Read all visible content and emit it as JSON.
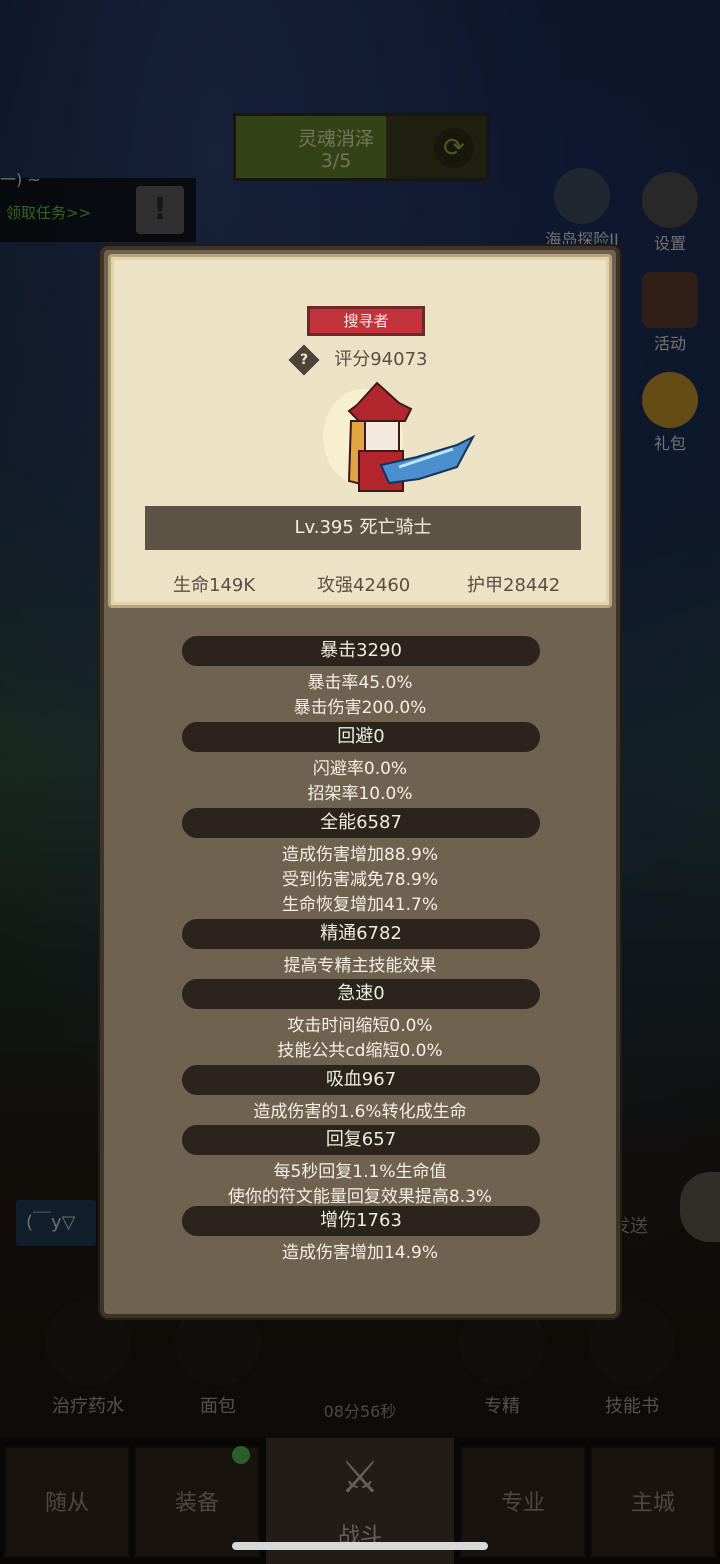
{
  "quest": {
    "title": "灵魂消泽",
    "progress": "3/5",
    "fill_fraction": 0.6
  },
  "task": {
    "top_text": "一) ~",
    "link": "领取任务>>"
  },
  "side_buttons": [
    {
      "label": "海岛探险II",
      "icon": "island-icon"
    },
    {
      "label": "设置",
      "icon": "gear-icon"
    },
    {
      "label": "活动",
      "icon": "calendar-icon"
    },
    {
      "label": "礼包",
      "icon": "gift-icon"
    }
  ],
  "character": {
    "rank": "搜寻者",
    "score": "评分94073",
    "name": "Lv.395 死亡骑士",
    "basic_stats": [
      "生命149K",
      "攻强42460",
      "护甲28442"
    ]
  },
  "stats": [
    {
      "header": "暴击3290",
      "lines": [
        "暴击率45.0%",
        "暴击伤害200.0%"
      ]
    },
    {
      "header": "回避0",
      "lines": [
        "闪避率0.0%",
        "招架率10.0%"
      ]
    },
    {
      "header": "全能6587",
      "lines": [
        "造成伤害增加88.9%",
        "受到伤害减免78.9%",
        "生命恢复增加41.7%"
      ]
    },
    {
      "header": "精通6782",
      "lines": [
        "提高专精主技能效果"
      ]
    },
    {
      "header": "急速0",
      "lines": [
        "攻击时间缩短0.0%",
        "技能公共cd缩短0.0%"
      ]
    },
    {
      "header": "吸血967",
      "lines": [
        "造成伤害的1.6%转化成生命"
      ]
    },
    {
      "header": "回复657",
      "lines": [
        "每5秒回复1.1%生命值",
        "使你的符文能量回复效果提高8.3%"
      ]
    },
    {
      "header": "增伤1763",
      "lines": [
        "造成伤害增加14.9%"
      ]
    }
  ],
  "chat": {
    "input_value": "(￣y▽",
    "send_label": "发送"
  },
  "items": [
    "治疗药水",
    "面包",
    "专精",
    "技能书"
  ],
  "timer": "08分56秒",
  "nav": [
    "随从",
    "装备",
    "战斗",
    "专业",
    "主城"
  ],
  "colors": {
    "rank_red": "#c2343b",
    "panel": "#6f6250",
    "parchment": "#ece3c6"
  }
}
